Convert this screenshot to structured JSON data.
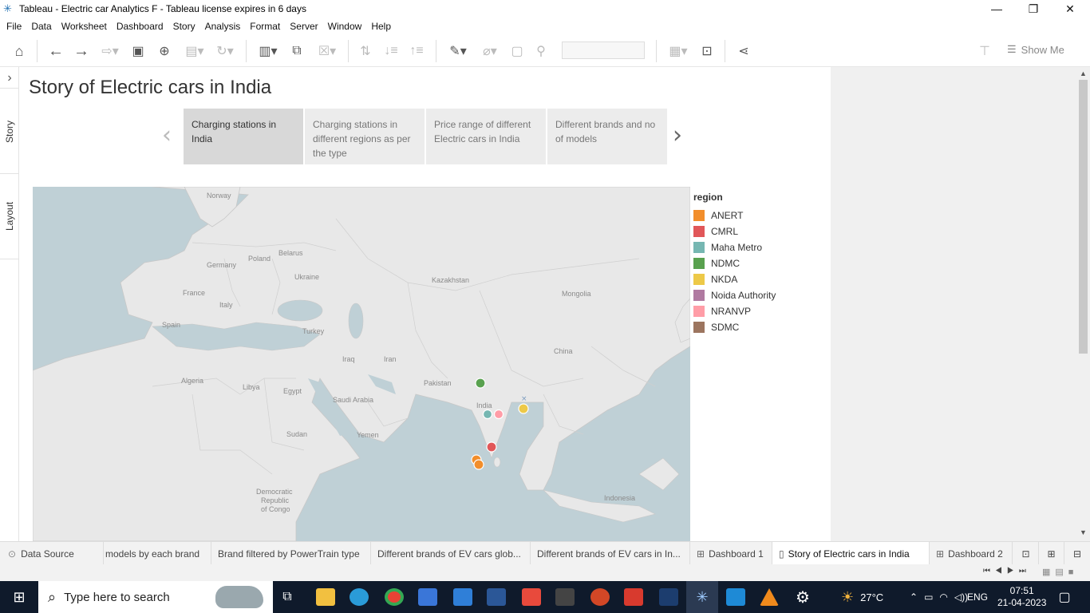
{
  "window": {
    "title": "Tableau - Electric car Analytics F - Tableau license expires in 6 days",
    "minimize": "—",
    "maximize": "❐",
    "close": "✕"
  },
  "menu": [
    "File",
    "Data",
    "Worksheet",
    "Dashboard",
    "Story",
    "Analysis",
    "Format",
    "Server",
    "Window",
    "Help"
  ],
  "toolbar": {
    "show_me": "Show Me"
  },
  "left_rail": {
    "expand": "›",
    "story_tab": "Story",
    "layout_tab": "Layout"
  },
  "story": {
    "title": "Story of Electric cars in India",
    "points": [
      {
        "label": "Charging stations in India",
        "active": true
      },
      {
        "label": "Charging stations in different regions as per the type",
        "active": false
      },
      {
        "label": "Price range of different Electric cars in India",
        "active": false
      },
      {
        "label": "Different brands and no of models",
        "active": false
      }
    ],
    "prev": "‹",
    "next": "›"
  },
  "map": {
    "labels": {
      "norway": "Norway",
      "belarus": "Belarus",
      "poland": "Poland",
      "germany": "Germany",
      "ukraine": "Ukraine",
      "kazakhstan": "Kazakhstan",
      "mongolia": "Mongolia",
      "france": "France",
      "italy": "Italy",
      "spain": "Spain",
      "turkey": "Turkey",
      "china": "China",
      "iraq": "Iraq",
      "iran": "Iran",
      "algeria": "Algeria",
      "libya": "Libya",
      "egypt": "Egypt",
      "saudi": "Saudi Arabia",
      "pakistan": "Pakistan",
      "india": "India",
      "sudan": "Sudan",
      "yemen": "Yemen",
      "drc1": "Democratic",
      "drc2": "Republic",
      "drc3": "of Congo",
      "indonesia": "Indonesia"
    }
  },
  "legend": {
    "title": "region",
    "items": [
      {
        "name": "ANERT",
        "color": "#f28e2b"
      },
      {
        "name": "CMRL",
        "color": "#e15759"
      },
      {
        "name": "Maha Metro",
        "color": "#76b7b2"
      },
      {
        "name": "NDMC",
        "color": "#59a14f"
      },
      {
        "name": "NKDA",
        "color": "#edc948"
      },
      {
        "name": "Noida Authority",
        "color": "#b07aa1"
      },
      {
        "name": "NRANVP",
        "color": "#ff9da7"
      },
      {
        "name": "SDMC",
        "color": "#9c755f"
      }
    ]
  },
  "sheet_tabs": [
    {
      "label": "Data Source",
      "icon": "database-icon"
    },
    {
      "label": "models by each brand"
    },
    {
      "label": "Brand filtered by PowerTrain type"
    },
    {
      "label": "Different brands of EV cars glob..."
    },
    {
      "label": "Different brands of EV cars in In..."
    },
    {
      "label": "Dashboard 1",
      "icon": "dashboard-icon"
    },
    {
      "label": "Story of Electric cars in India",
      "icon": "story-icon",
      "active": true
    },
    {
      "label": "Dashboard 2",
      "icon": "dashboard-icon"
    }
  ],
  "taskbar": {
    "search_placeholder": "Type here to search",
    "weather": "27°C",
    "language": "ENG",
    "time": "07:51",
    "date": "21-04-2023"
  }
}
